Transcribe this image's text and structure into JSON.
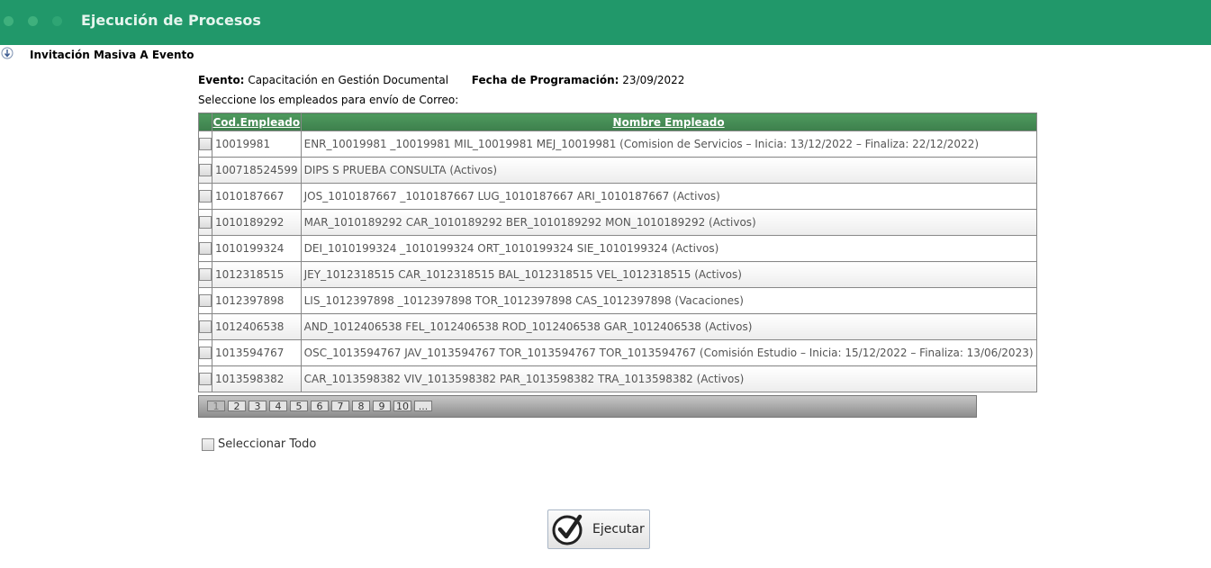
{
  "window": {
    "title": "Ejecución de Procesos"
  },
  "section": {
    "title": "Invitación Masiva A Evento"
  },
  "event": {
    "evento_label": "Evento:",
    "evento_value": "Capacitación en Gestión Documental",
    "fecha_label": "Fecha de Programación:",
    "fecha_value": "23/09/2022"
  },
  "instruction": "Seleccione los empleados para envío de Correo:",
  "table": {
    "headers": [
      "",
      "Cod.Empleado",
      "Nombre Empleado"
    ],
    "rows": [
      {
        "cod": "10019981",
        "nombre": "ENR_10019981 _10019981 MIL_10019981 MEJ_10019981 (Comision de Servicios – Inicia: 13/12/2022 – Finaliza: 22/12/2022)"
      },
      {
        "cod": "100718524599",
        "nombre": "DIPS S PRUEBA CONSULTA (Activos)"
      },
      {
        "cod": "1010187667",
        "nombre": "JOS_1010187667 _1010187667 LUG_1010187667 ARI_1010187667 (Activos)"
      },
      {
        "cod": "1010189292",
        "nombre": "MAR_1010189292 CAR_1010189292 BER_1010189292 MON_1010189292 (Activos)"
      },
      {
        "cod": "1010199324",
        "nombre": "DEI_1010199324 _1010199324 ORT_1010199324 SIE_1010199324 (Activos)"
      },
      {
        "cod": "1012318515",
        "nombre": "JEY_1012318515 CAR_1012318515 BAL_1012318515 VEL_1012318515 (Activos)"
      },
      {
        "cod": "1012397898",
        "nombre": "LIS_1012397898 _1012397898 TOR_1012397898 CAS_1012397898 (Vacaciones)"
      },
      {
        "cod": "1012406538",
        "nombre": "AND_1012406538 FEL_1012406538 ROD_1012406538 GAR_1012406538 (Activos)"
      },
      {
        "cod": "1013594767",
        "nombre": "OSC_1013594767 JAV_1013594767 TOR_1013594767 TOR_1013594767 (Comisión Estudio – Inicia: 15/12/2022 – Finaliza: 13/06/2023)"
      },
      {
        "cod": "1013598382",
        "nombre": "CAR_1013598382 VIV_1013598382 PAR_1013598382 TRA_1013598382 (Activos)"
      }
    ]
  },
  "pager": {
    "pages": [
      "1",
      "2",
      "3",
      "4",
      "5",
      "6",
      "7",
      "8",
      "9",
      "10",
      "..."
    ],
    "current": "1"
  },
  "select_all_label": "Seleccionar Todo",
  "execute_label": "Ejecutar",
  "colors": {
    "header_green": "#21986a",
    "grid_header": "#4e9a5e"
  },
  "icons": {
    "section": "arrow-down-icon",
    "execute": "checkmark-circle-icon"
  }
}
